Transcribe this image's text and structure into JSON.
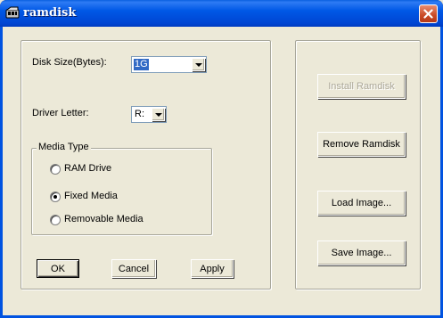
{
  "window": {
    "title": "ramdisk",
    "close_icon": "close-icon"
  },
  "disk_size": {
    "label": "Disk Size(Bytes):",
    "value": "1G"
  },
  "driver_letter": {
    "label": "Driver Letter:",
    "value": "R:"
  },
  "media_type": {
    "legend": "Media Type",
    "options": [
      {
        "label": "RAM Drive",
        "selected": false
      },
      {
        "label": "Fixed Media",
        "selected": true
      },
      {
        "label": "Removable Media",
        "selected": false
      }
    ]
  },
  "buttons": {
    "ok": "OK",
    "cancel": "Cancel",
    "apply": "Apply",
    "install": "Install Ramdisk",
    "remove": "Remove Ramdisk",
    "load": "Load Image...",
    "save": "Save Image..."
  }
}
